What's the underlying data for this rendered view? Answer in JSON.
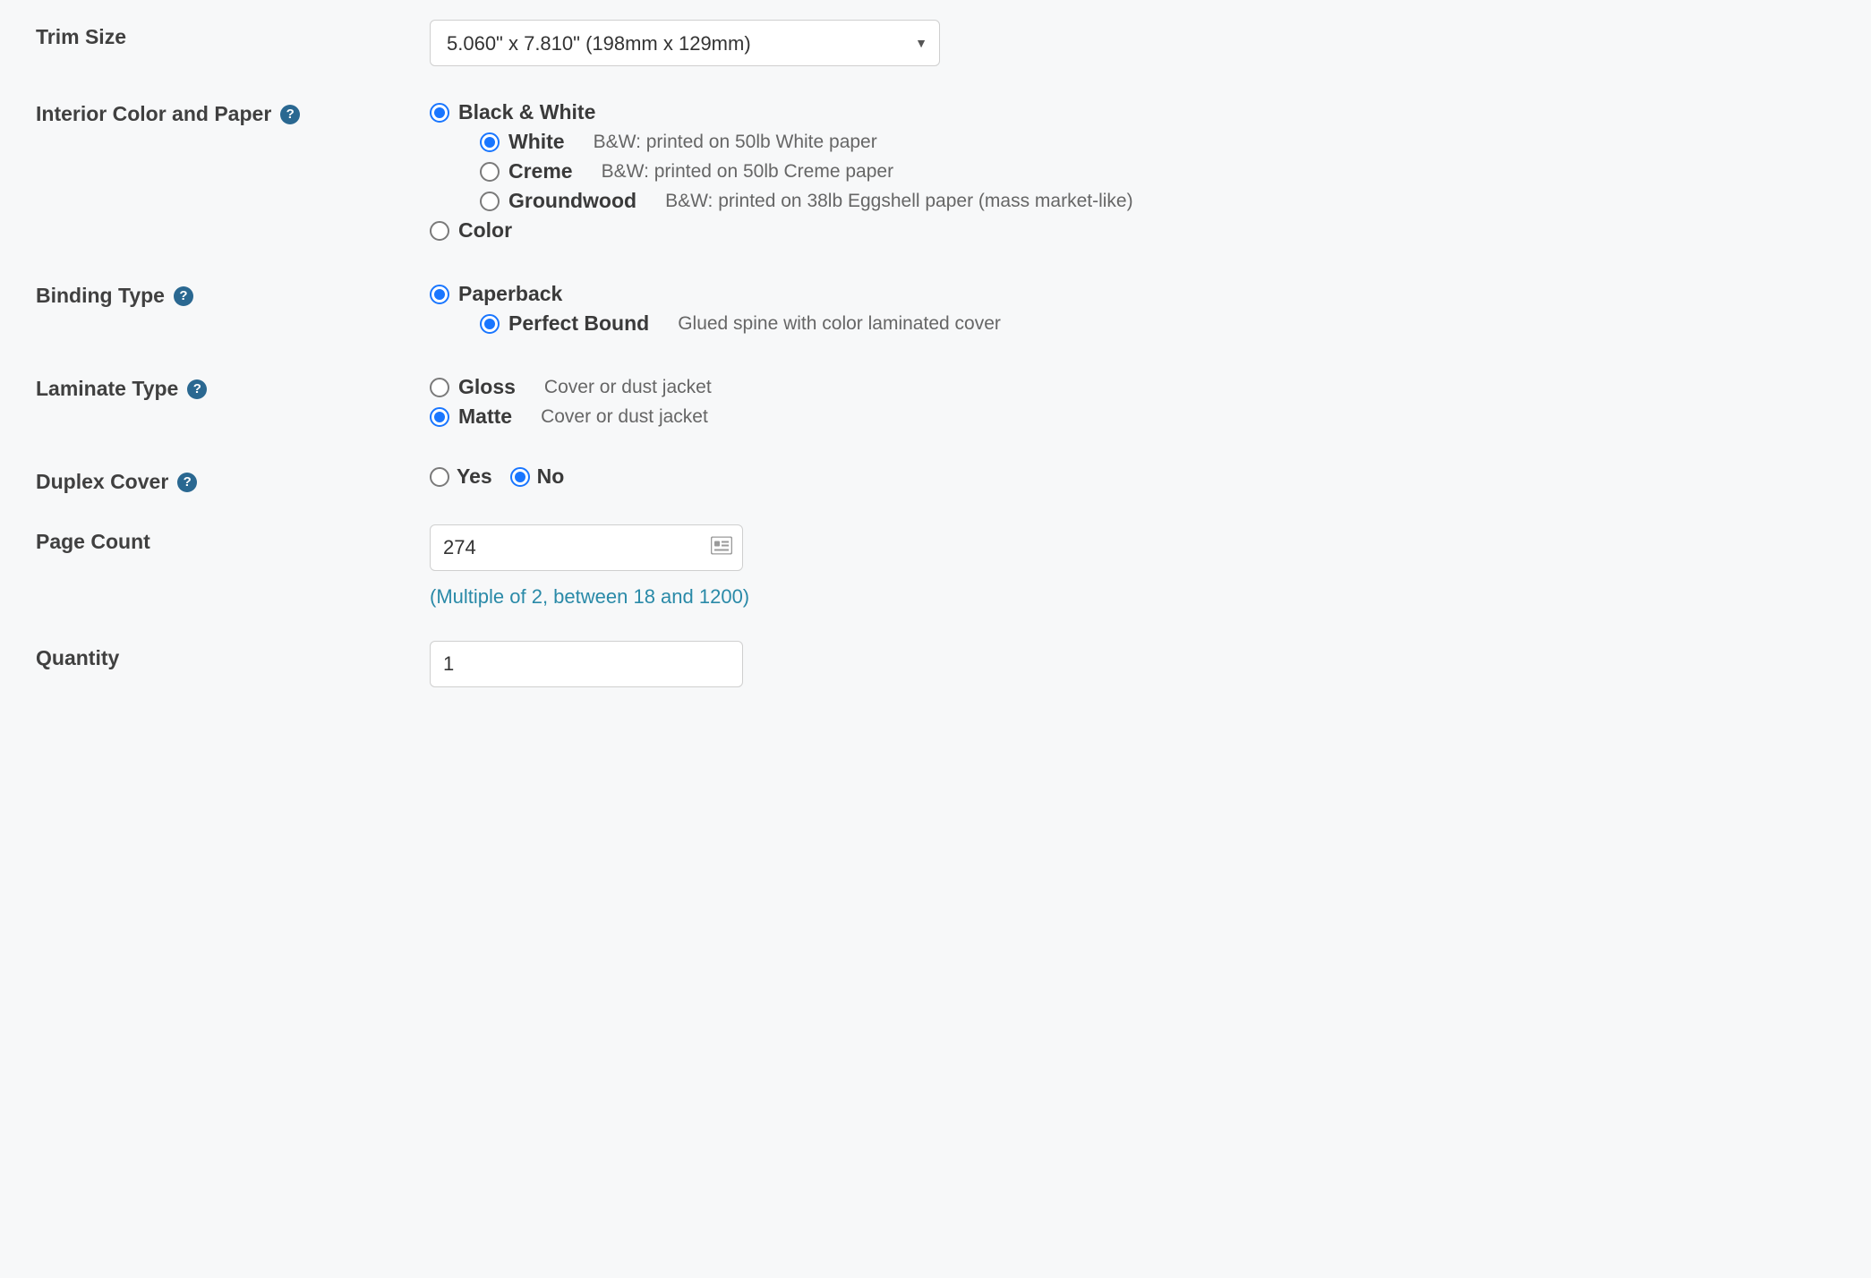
{
  "trimSize": {
    "label": "Trim Size",
    "selected": "5.060\" x 7.810\" (198mm x 129mm)"
  },
  "interior": {
    "label": "Interior Color and Paper",
    "bw": {
      "label": "Black & White"
    },
    "color": {
      "label": "Color"
    },
    "papers": {
      "white": {
        "label": "White",
        "desc": "B&W: printed on 50lb White paper"
      },
      "creme": {
        "label": "Creme",
        "desc": "B&W: printed on 50lb Creme paper"
      },
      "groundwood": {
        "label": "Groundwood",
        "desc": "B&W: printed on 38lb Eggshell paper (mass market-like)"
      }
    }
  },
  "binding": {
    "label": "Binding Type",
    "paperback": {
      "label": "Paperback"
    },
    "perfect": {
      "label": "Perfect Bound",
      "desc": "Glued spine with color laminated cover"
    }
  },
  "laminate": {
    "label": "Laminate Type",
    "gloss": {
      "label": "Gloss",
      "desc": "Cover or dust jacket"
    },
    "matte": {
      "label": "Matte",
      "desc": "Cover or dust jacket"
    }
  },
  "duplex": {
    "label": "Duplex Cover",
    "yes": "Yes",
    "no": "No"
  },
  "pageCount": {
    "label": "Page Count",
    "value": "274",
    "hint": "(Multiple of 2, between 18 and 1200)"
  },
  "quantity": {
    "label": "Quantity",
    "value": "1"
  }
}
